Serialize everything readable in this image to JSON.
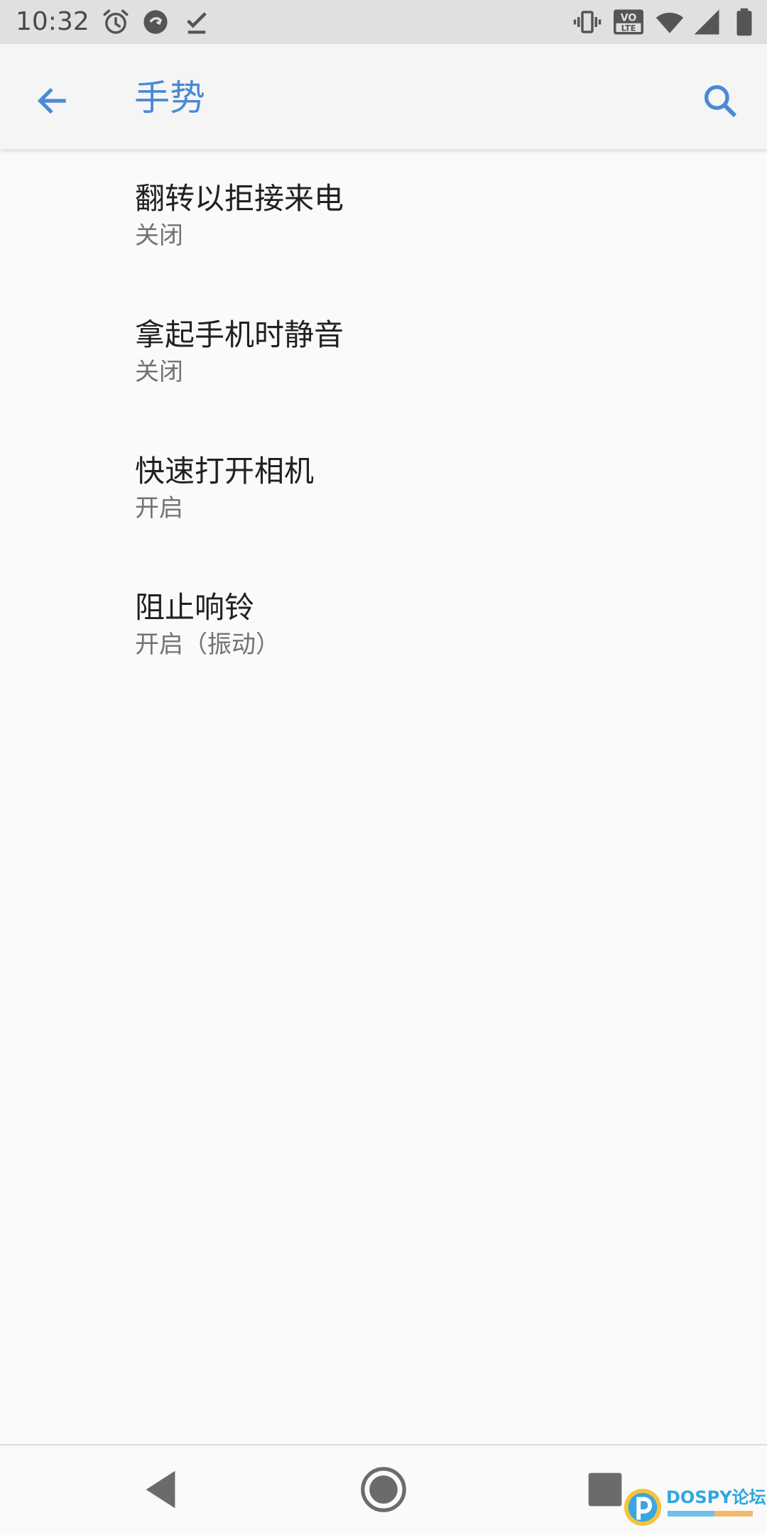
{
  "status_bar": {
    "time": "10:32",
    "icons_left": [
      "alarm-icon",
      "sync-off-icon",
      "download-done-icon"
    ],
    "icons_right": [
      "vibrate-icon",
      "volte-icon",
      "wifi-icon",
      "signal-icon",
      "battery-icon"
    ],
    "volte_label_top": "VO",
    "volte_label_bottom": "LTE"
  },
  "app_bar": {
    "title": "手势",
    "back_icon": "arrow-back-icon",
    "search_icon": "search-icon",
    "accent_color": "#4a8ad4"
  },
  "settings": [
    {
      "title": "翻转以拒接来电",
      "summary": "关闭"
    },
    {
      "title": "拿起手机时静音",
      "summary": "关闭"
    },
    {
      "title": "快速打开相机",
      "summary": "开启"
    },
    {
      "title": "阻止响铃",
      "summary": "开启（振动）"
    }
  ],
  "nav_bar": {
    "buttons": [
      "nav-back-icon",
      "nav-home-icon",
      "nav-recents-icon"
    ]
  },
  "watermark": {
    "text": "DOSPY论坛"
  }
}
